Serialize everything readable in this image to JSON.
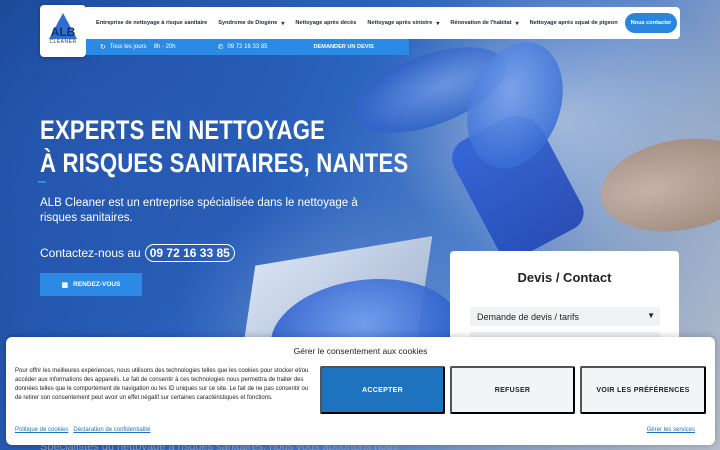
{
  "logo": {
    "text": "ALB",
    "sub": "CLEANER"
  },
  "nav": {
    "items": [
      {
        "label": "Entreprise de nettoyage à risque sanitaire",
        "caret": false
      },
      {
        "label": "Syndrome de Diogène",
        "caret": true
      },
      {
        "label": "Nettoyage après décès",
        "caret": false
      },
      {
        "label": "Nettoyage après sinistre",
        "caret": true
      },
      {
        "label": "Rénovation de l'habitat",
        "caret": true
      },
      {
        "label": "Nettoyage après squat de pigeon",
        "caret": false
      }
    ],
    "contact_button": "Nous contacter"
  },
  "subbar": {
    "hours_label": "Tous les jours",
    "hours": "8h - 20h",
    "phone": "09 72 16 33 85",
    "devis": "DEMANDER UN DEVIS"
  },
  "hero": {
    "title_line1": "EXPERTS EN NETTOYAGE",
    "title_line2": "À RISQUES SANITAIRES, NANTES",
    "description": "ALB Cleaner est un entreprise spécialisée dans le nettoyage à risques sanitaires.",
    "contact_prefix": "Contactez-nous au",
    "phone": "09 72 16 33 85",
    "rdv_button": "RENDEZ-VOUS"
  },
  "devis": {
    "title": "Devis / Contact",
    "select_value": "Demande de devis / tarifs"
  },
  "below_text": "Spécialistes du nettoyage à risques sanitaires, nous vous apportons notre",
  "cookie": {
    "title": "Gérer le consentement aux cookies",
    "body": "Pour offrir les meilleures expériences, nous utilisons des technologies telles que les cookies pour stocker et/ou accéder aux informations des appareils. Le fait de consentir à ces technologies nous permettra de traiter des données telles que le comportement de navigation ou les ID uniques sur ce site. Le fait de ne pas consentir ou de retirer son consentement peut avoir un effet négatif sur certaines caractéristiques et fonctions.",
    "accept": "ACCEPTER",
    "refuse": "REFUSER",
    "prefs": "VOIR LES PRÉFÉRENCES",
    "link_policy": "Politique de cookies",
    "link_privacy": "Déclaration de confidentialité",
    "manage": "Gérer les services"
  },
  "colors": {
    "accent": "#2b8ae3",
    "accept": "#1e73be",
    "hero": "#1f4fa0"
  },
  "icons": {
    "hours": "history-icon",
    "phone": "whatsapp-icon",
    "calendar": "calendar-icon",
    "caret": "chevron-down-icon"
  }
}
